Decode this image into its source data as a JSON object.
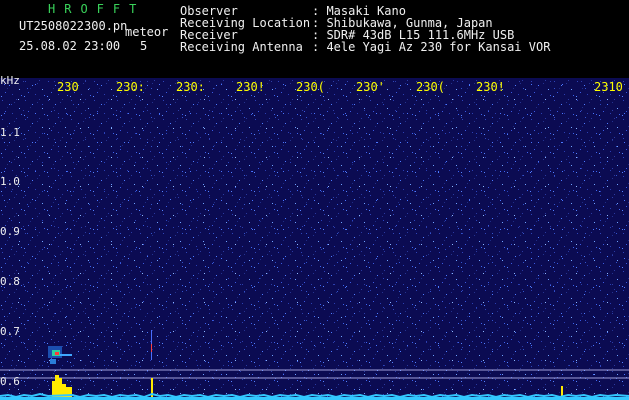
{
  "header": {
    "brand": "HROFFT",
    "filename": "UT2508022300.pn",
    "detector_label": "meteor",
    "datetime": "25.08.02 23:00",
    "count": "5"
  },
  "info": {
    "observer_label": "Observer",
    "observer_value": ": Masaki Kano",
    "location_label": "Receiving Location",
    "location_value": ": Shibukawa, Gunma, Japan",
    "receiver_label": "Receiver",
    "receiver_value": ": SDR# 43dB L15 111.6MHz USB",
    "antenna_label": "Receiving Antenna",
    "antenna_value": ": 4ele Yagi Az 230 for Kansai VOR"
  },
  "axes": {
    "y_unit": "kHz",
    "y_ticks": [
      "1.1",
      "1.0",
      "0.9",
      "0.8",
      "0.7",
      "0.6"
    ],
    "x_ticks": [
      "230",
      "230:",
      "230:",
      "230!",
      "230(",
      "230'",
      "230(",
      "230!",
      "2310"
    ]
  },
  "colors": {
    "background": "#0b0b52",
    "text": "#f0f0f0",
    "brand": "#39d25a",
    "tick_x": "#ffff00",
    "signal": "#ffea00",
    "baseline": "#33c8ff"
  }
}
